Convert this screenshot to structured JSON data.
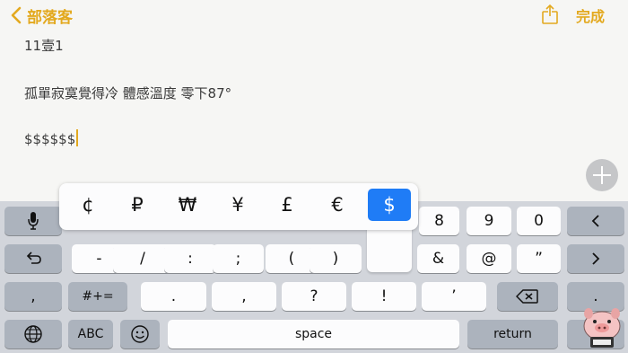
{
  "nav": {
    "back_label": "部落客",
    "done_label": "完成"
  },
  "note": {
    "line1": "11壹1",
    "line2": "孤單寂寞覺得冷 體感溫度 零下87°",
    "line3": "$$$$$$"
  },
  "popup": {
    "currencies": [
      "¢",
      "₽",
      "₩",
      "¥",
      "£",
      "€",
      "$"
    ],
    "selected": "$"
  },
  "keys": {
    "row1": [
      "8",
      "9",
      "0"
    ],
    "row2": [
      "-",
      "/",
      ":",
      ";",
      "(",
      ")",
      "&",
      "@",
      "”"
    ],
    "row3_sym": "#+=",
    "row3": [
      ".",
      ",",
      "?",
      "!",
      "’"
    ],
    "row3_left": ",",
    "row3_right": ".",
    "abc": "ABC",
    "space": "space",
    "return": "return"
  },
  "colors": {
    "accent": "#e3a91f",
    "selected_key": "#1f7cf6"
  },
  "icons": [
    "chevron-left-icon",
    "share-icon",
    "plus-icon",
    "microphone-icon",
    "chevron-left-key-icon",
    "undo-icon",
    "chevron-right-icon",
    "backspace-icon",
    "globe-icon",
    "emoji-icon"
  ]
}
